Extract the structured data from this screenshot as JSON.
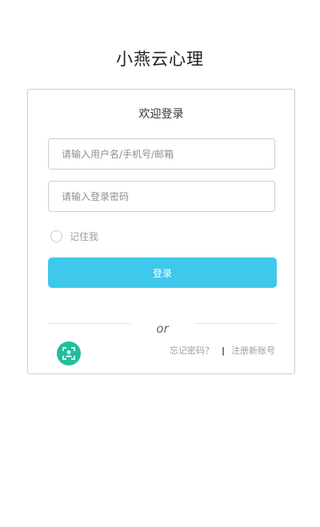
{
  "app": {
    "title": "小燕云心理"
  },
  "login": {
    "heading": "欢迎登录",
    "username_placeholder": "请输入用户名/手机号/邮箱",
    "password_placeholder": "请输入登录密码",
    "remember_label": "记住我",
    "submit_label": "登录",
    "or_text": "or",
    "forgot_label": "忘记密码？",
    "separator": "|",
    "register_label": "注册新账号",
    "face_icon": "face-recognition-icon"
  },
  "colors": {
    "accent": "#3ec8ec",
    "face_button": "#1fbf9b"
  }
}
